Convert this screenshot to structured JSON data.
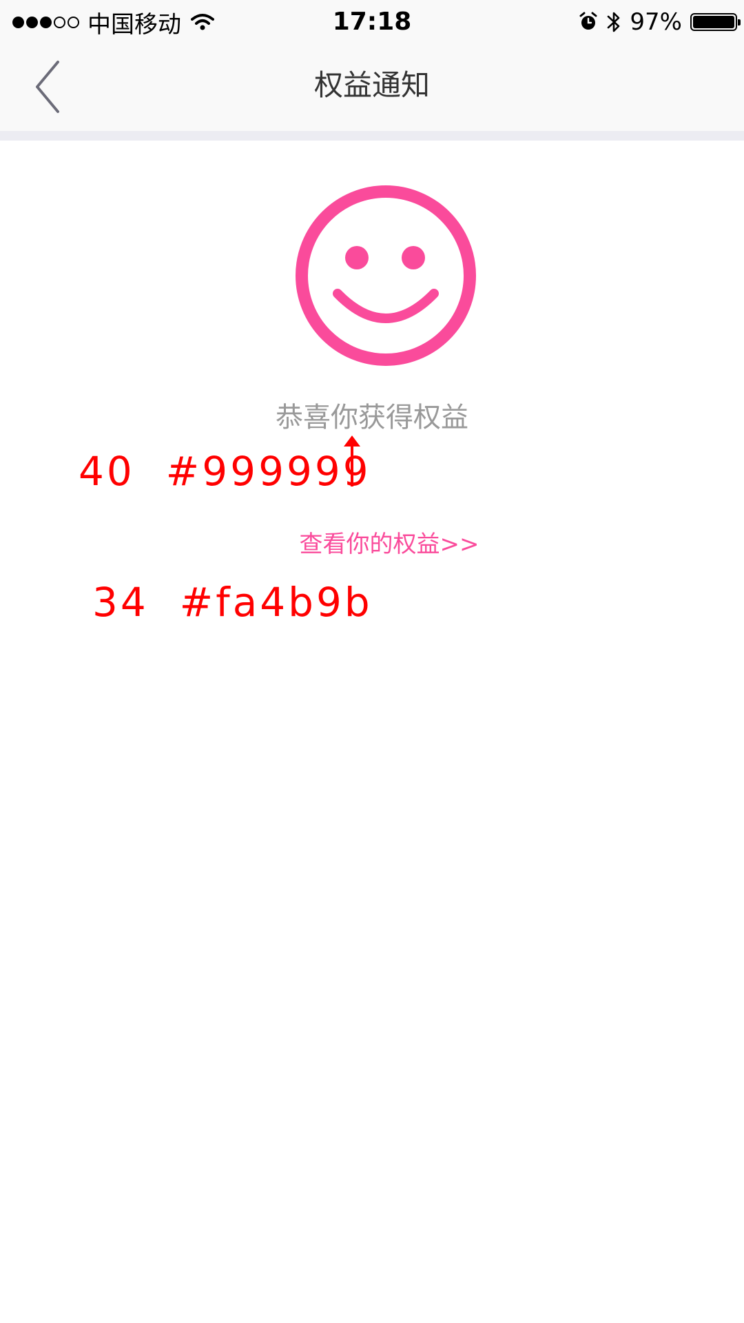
{
  "status_bar": {
    "carrier": "中国移动",
    "time": "17:18",
    "battery_percent": "97%",
    "signal_bars_filled": 3,
    "signal_bars_total": 5,
    "icons": [
      "wifi-icon",
      "alarm-icon",
      "bluetooth-icon",
      "battery-icon"
    ]
  },
  "nav": {
    "title": "权益通知",
    "back_icon": "chevron-left-icon"
  },
  "content": {
    "icon": "smiley-face-icon",
    "icon_color": "#fa4b9b",
    "message": "恭喜你获得权益",
    "link": "查看你的权益>>",
    "link_color": "#fa4b9b",
    "message_color": "#999999"
  },
  "annotations": {
    "message_spec": "40  #999999",
    "link_spec": "34  #fa4b9b",
    "annotation_color": "#ff0000"
  }
}
